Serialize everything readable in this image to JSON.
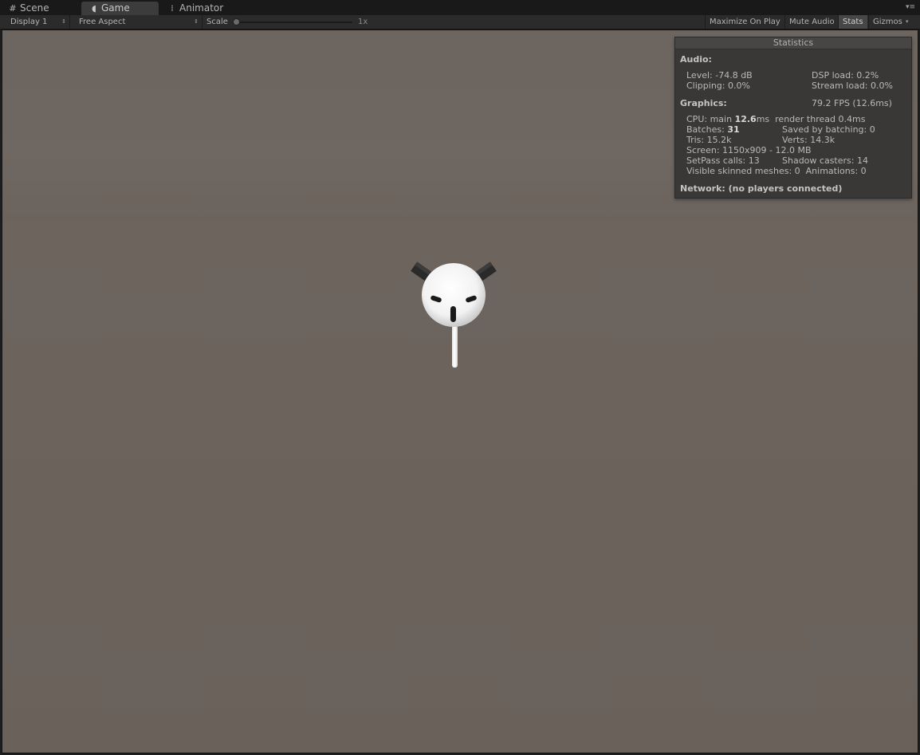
{
  "tabs": [
    {
      "label": "Scene",
      "icon": "grid-icon"
    },
    {
      "label": "Game",
      "icon": "pacman-icon",
      "active": true
    },
    {
      "label": "Animator",
      "icon": "animator-icon"
    }
  ],
  "toolbar": {
    "display": "Display 1",
    "aspect": "Free Aspect",
    "scale_label": "Scale",
    "scale_value": "1x",
    "maximize_on_play": "Maximize On Play",
    "mute_audio": "Mute Audio",
    "stats": "Stats",
    "gizmos": "Gizmos"
  },
  "statistics": {
    "title": "Statistics",
    "audio": {
      "heading": "Audio:",
      "level": "Level: -74.8 dB",
      "dsp_load": "DSP load: 0.2%",
      "clipping": "Clipping: 0.0%",
      "stream_load": "Stream load: 0.0%"
    },
    "graphics": {
      "heading": "Graphics:",
      "fps": "79.2 FPS (12.6ms)",
      "cpu_prefix": "CPU: main ",
      "cpu_main": "12.6",
      "cpu_suffix": "ms  render thread 0.4ms",
      "batches_prefix": "Batches: ",
      "batches": "31",
      "saved_by_batching": "Saved by batching: 0",
      "tris": "Tris: 15.2k",
      "verts": "Verts: 14.3k",
      "screen": "Screen: 1150x909 - 12.0 MB",
      "setpass": "SetPass calls: 13",
      "shadow_casters": "Shadow casters: 14",
      "visible_skinned": "Visible skinned meshes: 0  Animations: 0"
    },
    "network": "Network: (no players connected)"
  },
  "colors": {
    "viewport_bg": "#6b625c",
    "panel_bg": "#383735",
    "toolbar_bg": "#2b2b2b"
  }
}
